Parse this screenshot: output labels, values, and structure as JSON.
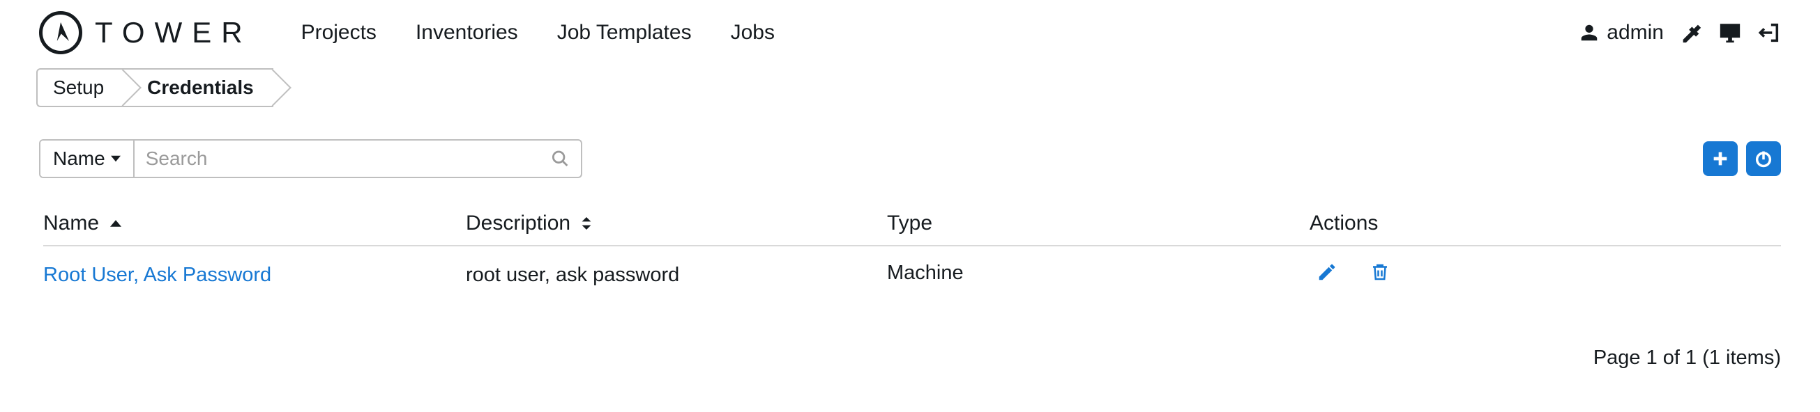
{
  "brand": "TOWER",
  "nav": {
    "projects": "Projects",
    "inventories": "Inventories",
    "job_templates": "Job Templates",
    "jobs": "Jobs"
  },
  "user": {
    "name": "admin"
  },
  "breadcrumb": {
    "setup": "Setup",
    "credentials": "Credentials"
  },
  "search": {
    "filter_label": "Name",
    "placeholder": "Search"
  },
  "columns": {
    "name": "Name",
    "description": "Description",
    "type": "Type",
    "actions": "Actions"
  },
  "rows": [
    {
      "name": "Root User, Ask Password",
      "description": "root user, ask password",
      "type": "Machine"
    }
  ],
  "pagination": "Page 1 of 1 (1 items)"
}
